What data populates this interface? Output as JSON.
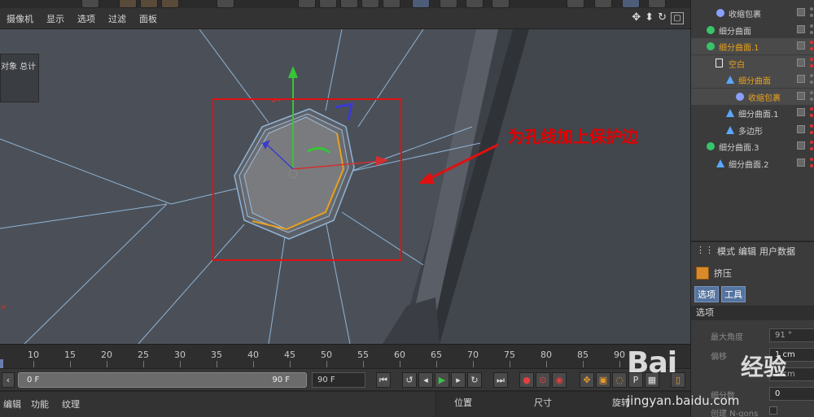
{
  "viewport_menu": [
    "摄像机",
    "显示",
    "选项",
    "过滤",
    "面板"
  ],
  "hud_text": "对象 总计",
  "annotation": "为孔线加上保护边",
  "object_manager": [
    {
      "label": "收缩包裹",
      "indent": 1,
      "icon": "wrap",
      "highlight": false,
      "red": false
    },
    {
      "label": "细分曲面",
      "indent": 0,
      "icon": "subdiv",
      "highlight": false,
      "red": false
    },
    {
      "label": "细分曲面.1",
      "indent": 0,
      "icon": "subdiv",
      "highlight": true,
      "red": true
    },
    {
      "label": "空白",
      "indent": 1,
      "icon": "null",
      "highlight": true,
      "red": true
    },
    {
      "label": "细分曲面",
      "indent": 2,
      "icon": "tri",
      "highlight": true,
      "red": false
    },
    {
      "label": "收缩包裹",
      "indent": 3,
      "icon": "wrap",
      "highlight": true,
      "red": false
    },
    {
      "label": "细分曲面.1",
      "indent": 2,
      "icon": "tri",
      "highlight": false,
      "red": true
    },
    {
      "label": "多边形",
      "indent": 2,
      "icon": "tri",
      "highlight": false,
      "red": true
    },
    {
      "label": "细分曲面.3",
      "indent": 0,
      "icon": "subdiv",
      "highlight": false,
      "red": true
    },
    {
      "label": "细分曲面.2",
      "indent": 1,
      "icon": "tri",
      "highlight": false,
      "red": true
    }
  ],
  "attributes": {
    "tabs": [
      "模式",
      "编辑",
      "用户数据"
    ],
    "object_name": "挤压",
    "subtabs": [
      "选项",
      "工具"
    ],
    "section": "选项",
    "fields": [
      {
        "label": "最大角度",
        "value": "91 °",
        "active": false
      },
      {
        "label": "偏移",
        "value": "1 cm",
        "active": true
      },
      {
        "label": "",
        "value": "5 cm",
        "active": false
      },
      {
        "label": "细分数",
        "value": "0",
        "active": true
      },
      {
        "label": "创建 N-gons",
        "value": "",
        "active": false
      }
    ]
  },
  "timeline": {
    "ticks": [
      "10",
      "15",
      "20",
      "25",
      "30",
      "35",
      "40",
      "45",
      "50",
      "55",
      "60",
      "65",
      "70",
      "75",
      "80",
      "85",
      "90"
    ],
    "start_frame": "0 F",
    "end_frame": "90 F",
    "current": "90 F"
  },
  "bottom_menu": [
    "编辑",
    "功能",
    "纹理"
  ],
  "coord_tabs": [
    "位置",
    "尺寸",
    "旋转"
  ],
  "watermark": {
    "brand": "Bai",
    "brand2": "经验",
    "url": "jingyan.baidu.com"
  },
  "colors": {
    "highlight": "#e8a11c",
    "annotation": "#e10000",
    "mesh": "#4b5058",
    "wire": "#8fb3d6"
  }
}
